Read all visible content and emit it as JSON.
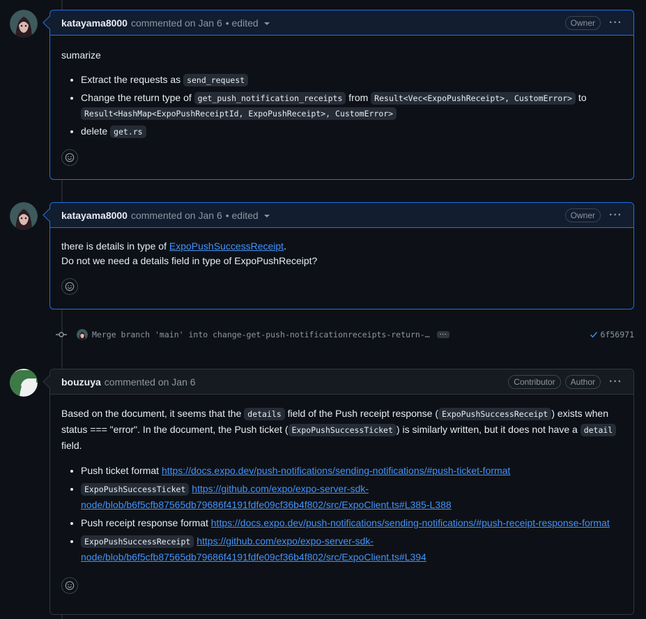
{
  "comments": [
    {
      "author": "katayama8000",
      "meta": "commented on Jan 6",
      "edited": "• edited",
      "badges": [
        "Owner"
      ],
      "title": "sumarize",
      "items": [
        {
          "pre": "Extract the requests as ",
          "code": "send_request"
        },
        {
          "pre": "Change the return type of ",
          "code1": "get_push_notification_receipts",
          "mid": " from ",
          "code2": "Result<Vec<ExpoPushReceipt>, CustomError>",
          "mid2": " to ",
          "code3": "Result<HashMap<ExpoPushReceiptId, ExpoPushReceipt>, CustomError>"
        },
        {
          "pre": "delete ",
          "code": "get.rs"
        }
      ]
    },
    {
      "author": "katayama8000",
      "meta": "commented on Jan 6",
      "edited": "• edited",
      "badges": [
        "Owner"
      ],
      "line1_pre": "there is details in type of ",
      "line1_link": "ExpoPushSuccessReceipt",
      "line1_post": ".",
      "line2": "Do not we need a details field in type of ExpoPushReceipt?"
    },
    {
      "author": "bouzuya",
      "meta": "commented on Jan 6",
      "badges": [
        "Contributor",
        "Author"
      ],
      "para": {
        "t1": "Based on the document, it seems that the ",
        "c1": "details",
        "t2": " field of the Push receipt response (",
        "c2": "ExpoPushSuccessReceipt",
        "t3": ") exists when status === \"error\". In the document, the Push ticket (",
        "c3": "ExpoPushSuccessTicket",
        "t4": ") is similarly written, but it does not have a ",
        "c4": "detail",
        "t5": " field."
      },
      "items": [
        {
          "pre": "Push ticket format ",
          "link": "https://docs.expo.dev/push-notifications/sending-notifications/#push-ticket-format"
        },
        {
          "code": "ExpoPushSuccessTicket",
          "link": "https://github.com/expo/expo-server-sdk-node/blob/b6f5cfb87565db79686f4191fdfe09cf36b4f802/src/ExpoClient.ts#L385-L388"
        },
        {
          "pre": "Push receipt response format ",
          "link": "https://docs.expo.dev/push-notifications/sending-notifications/#push-receipt-response-format"
        },
        {
          "code": "ExpoPushSuccessReceipt",
          "link": "https://github.com/expo/expo-server-sdk-node/blob/b6f5cfb87565db79686f4191fdfe09cf36b4f802/src/ExpoClient.ts#L394"
        }
      ]
    }
  ],
  "commit": {
    "message": "Merge branch 'main' into change-get-push-notificationreceipts-return-…",
    "more": "···",
    "sha": "6f56971"
  },
  "colors": {
    "accent": "#1f6feb",
    "link": "#4493f8",
    "bg": "#0d1117"
  }
}
